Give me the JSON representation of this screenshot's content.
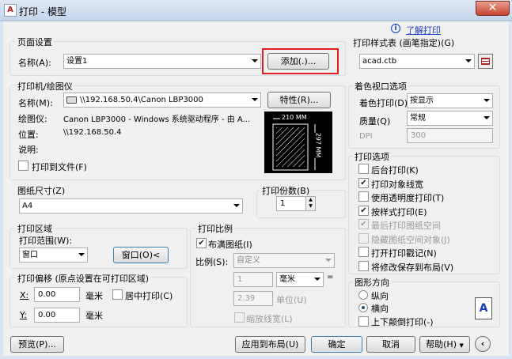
{
  "window": {
    "title": "打印 - 模型",
    "close": "✕",
    "app_icon": "A"
  },
  "help_link": "了解打印",
  "page_setup": {
    "group": "页面设置",
    "name_label": "名称(A):",
    "name_value": "设置1",
    "add_button": "添加(.)..."
  },
  "printer": {
    "group": "打印机/绘图仪",
    "name_label": "名称(M):",
    "name_value": "\\\\192.168.50.4\\Canon LBP3000",
    "properties_button": "特性(R)...",
    "plotter_label": "绘图仪:",
    "plotter_value": "Canon LBP3000 - Windows 系统驱动程序 - 由 A...",
    "location_label": "位置:",
    "location_value": "\\\\192.168.50.4",
    "description_label": "说明:",
    "print_to_file": "打印到文件(F)",
    "preview_width": "210 MM",
    "preview_height": "297 MM"
  },
  "paper_size": {
    "group": "图纸尺寸(Z)",
    "value": "A4"
  },
  "copies": {
    "group": "打印份数(B)",
    "value": "1"
  },
  "plot_area": {
    "group": "打印区域",
    "range_label": "打印范围(W):",
    "range_value": "窗口",
    "window_button": "窗口(O)<"
  },
  "plot_offset": {
    "group": "打印偏移 (原点设置在可打印区域)",
    "x_label": "X:",
    "x_value": "0.00",
    "y_label": "Y:",
    "y_value": "0.00",
    "unit": "毫米",
    "center_label": "居中打印(C)"
  },
  "plot_scale": {
    "group": "打印比例",
    "fit_label": "布满图纸(I)",
    "scale_label": "比例(S):",
    "scale_value": "自定义",
    "value1": "1",
    "unit1": "毫米",
    "value2": "2.39",
    "unit2": "单位(U)",
    "lineweights": "缩放线宽(L)"
  },
  "style_table": {
    "group": "打印样式表 (画笔指定)(G)",
    "value": "acad.ctb"
  },
  "shaded": {
    "group": "着色视口选项",
    "shade_label": "着色打印(D)",
    "shade_value": "按显示",
    "quality_label": "质量(Q)",
    "quality_value": "常规",
    "dpi_label": "DPI",
    "dpi_value": "300"
  },
  "options": {
    "group": "打印选项",
    "items": [
      {
        "label": "后台打印(K)",
        "checked": false,
        "enabled": true
      },
      {
        "label": "打印对象线宽",
        "checked": true,
        "enabled": true
      },
      {
        "label": "使用透明度打印(T)",
        "checked": false,
        "enabled": true
      },
      {
        "label": "按样式打印(E)",
        "checked": true,
        "enabled": true
      },
      {
        "label": "最后打印图纸空间",
        "checked": true,
        "enabled": false
      },
      {
        "label": "隐藏图纸空间对象(J)",
        "checked": false,
        "enabled": false
      },
      {
        "label": "打开打印戳记(N)",
        "checked": false,
        "enabled": true
      },
      {
        "label": "将修改保存到布局(V)",
        "checked": false,
        "enabled": true
      }
    ]
  },
  "orientation": {
    "group": "图形方向",
    "portrait": "纵向",
    "landscape": "横向",
    "upside_down": "上下颠倒打印(-)",
    "selected": "landscape",
    "icon_letter": "A"
  },
  "footer": {
    "preview": "预览(P)...",
    "apply": "应用到布局(U)",
    "ok": "确定",
    "cancel": "取消",
    "help": "帮助(H)"
  },
  "colors": {
    "highlight": "#e02020",
    "link": "#1a3dbf"
  }
}
